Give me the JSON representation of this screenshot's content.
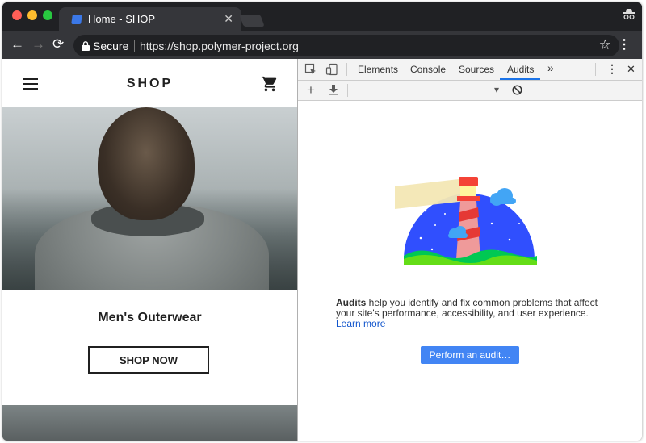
{
  "window": {
    "colors": {
      "close": "#ff5f57",
      "minimize": "#febc2e",
      "maximize": "#28c840"
    }
  },
  "tab": {
    "title": "Home - SHOP",
    "close_glyph": "✕"
  },
  "toolbar": {
    "back_glyph": "←",
    "forward_glyph": "→",
    "reload_glyph": "⟳",
    "secure_label": "Secure",
    "url": "https://shop.polymer-project.org",
    "star_glyph": "☆",
    "menu_glyph": "⋮"
  },
  "page": {
    "logo": "SHOP",
    "category_title": "Men's Outerwear",
    "shop_now": "SHOP NOW"
  },
  "devtools": {
    "tabs": [
      "Elements",
      "Console",
      "Sources",
      "Audits"
    ],
    "active_tab": "Audits",
    "more_glyph": "»",
    "menu_glyph": "⋮",
    "close_glyph": "✕",
    "add_glyph": "+",
    "dropdown_glyph": "▾",
    "description_bold": "Audits",
    "description_text": " help you identify and fix common problems that affect your site's performance, accessibility, and user experience. ",
    "learn_more": "Learn more",
    "button": "Perform an audit…",
    "accent": "#4285f4"
  }
}
